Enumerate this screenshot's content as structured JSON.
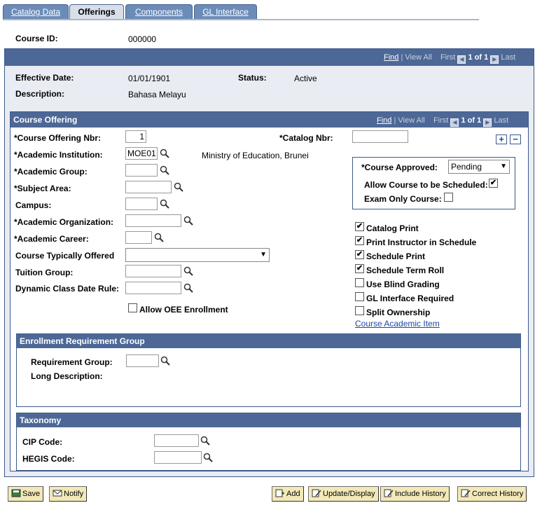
{
  "tabs": [
    {
      "label": "Catalog Data"
    },
    {
      "label": "Offerings"
    },
    {
      "label": "Components"
    },
    {
      "label": "GL Interface"
    }
  ],
  "header": {
    "course_id_label": "Course ID:",
    "course_id_value": "000000"
  },
  "nav": {
    "find": "Find",
    "view_all": "View All",
    "first": "First",
    "count": "1 of 1",
    "last": "Last"
  },
  "effective": {
    "date_label": "Effective Date:",
    "date_value": "01/01/1901",
    "status_label": "Status:",
    "status_value": "Active",
    "desc_label": "Description:",
    "desc_value": "Bahasa Melayu"
  },
  "offering": {
    "title": "Course Offering",
    "nbr_label": "*Course Offering Nbr:",
    "nbr_value": "1",
    "catalog_label": "*Catalog Nbr:",
    "catalog_value": "",
    "institution_label": "*Academic Institution:",
    "institution_value": "MOE01",
    "institution_desc": "Ministry of Education, Brunei",
    "group_label": "*Academic Group:",
    "subject_label": "*Subject Area:",
    "campus_label": "Campus:",
    "org_label": "*Academic Organization:",
    "career_label": "*Academic Career:",
    "typically_label": "Course Typically Offered",
    "tuition_label": "Tuition Group:",
    "dynamic_label": "Dynamic Class Date Rule:",
    "oee_label": "Allow OEE Enrollment",
    "approved_label": "*Course Approved:",
    "approved_value": "Pending",
    "allow_sched_label": "Allow Course to be Scheduled:",
    "exam_only_label": "Exam Only Course:",
    "checks": [
      {
        "label": "Catalog Print",
        "checked": "✔"
      },
      {
        "label": "Print Instructor in Schedule",
        "checked": "✔"
      },
      {
        "label": "Schedule Print",
        "checked": "✔"
      },
      {
        "label": "Schedule Term Roll",
        "checked": "✔"
      },
      {
        "label": "Use Blind Grading",
        "checked": ""
      },
      {
        "label": "GL Interface Required",
        "checked": ""
      },
      {
        "label": "Split Ownership",
        "checked": ""
      }
    ],
    "academic_item_link": "Course Academic Item",
    "add_row": "+",
    "delete_row": "−"
  },
  "enrollment": {
    "title": "Enrollment Requirement Group",
    "req_group_label": "Requirement Group:",
    "long_desc_label": "Long Description:"
  },
  "taxonomy": {
    "title": "Taxonomy",
    "cip_label": "CIP Code:",
    "hegis_label": "HEGIS Code:"
  },
  "buttons": {
    "save": "Save",
    "notify": "Notify",
    "add": "Add",
    "update": "Update/Display",
    "include_history": "Include History",
    "correct_history": "Correct History"
  }
}
